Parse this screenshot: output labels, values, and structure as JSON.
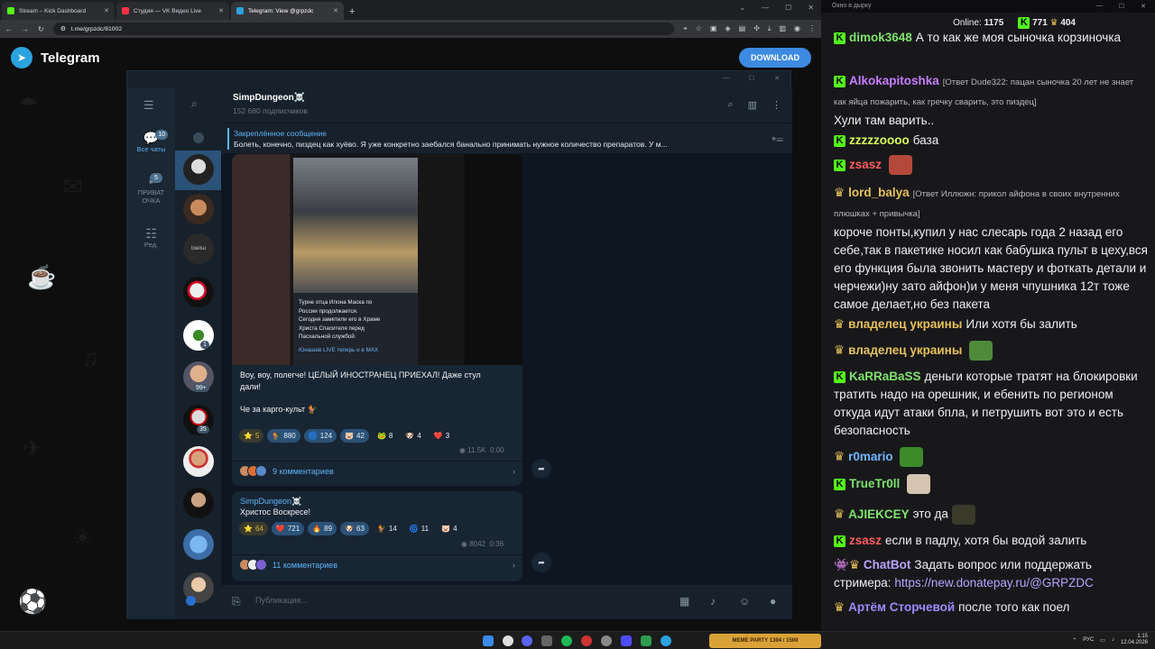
{
  "browser": {
    "tabs": [
      {
        "title": "Stream – Kick Dashboard",
        "fav_color": "#53fc18"
      },
      {
        "title": "Студия — VK Видео Live",
        "fav_color": "#ff3347"
      },
      {
        "title": "Telegram: View @grpzdc",
        "fav_color": "#2aa3de",
        "active": true
      }
    ],
    "new_tab_symbol": "+",
    "url": "t.me/grpzdc/81002"
  },
  "telegram": {
    "brand": "Telegram",
    "download_label": "DOWNLOAD",
    "folders": [
      {
        "label": "Все чаты",
        "icon": "chat-bubbles-icon",
        "badge": "10",
        "active": true
      },
      {
        "label": "ПРИВАТ ОЧКА",
        "icon": "chat-bubble-icon",
        "badge": "5"
      },
      {
        "label": "Ред.",
        "icon": "sliders-icon"
      }
    ],
    "chatlist_badges": [
      "1",
      "99+",
      "35"
    ],
    "chat_title": "SimpDungeon☠️",
    "chat_subtitle": "152 680 подписчиков",
    "pinned_title": "Закреплённое сообщение",
    "pinned_text": "Болеть, конечно, пиздец как хуёво. Я уже конкретно заебался банально принимать нужное количество препаратов. У м...",
    "post1": {
      "image_caption": [
        "Турне отца Илона Маска по",
        "России продолжается.",
        "Сегодня заметили его в Храме",
        "Христа Спасителя перед",
        "Пасхальной службой."
      ],
      "image_footer": "Юнашев LIVE теперь и в MAX",
      "text_lines": [
        "Воу, воу, полегче! ЦЕЛЫЙ ИНОСТРАНЕЦ ПРИЕХАЛ! Даже стул",
        "дали!"
      ],
      "text2": "Че за карго-культ 🐓",
      "reactions": [
        {
          "emoji": "⭐",
          "count": "5",
          "gold": true
        },
        {
          "emoji": "🐓",
          "count": "880"
        },
        {
          "emoji": "🌀",
          "count": "124"
        },
        {
          "emoji": "🐷",
          "count": "42"
        },
        {
          "emoji": "🐸",
          "count": "8"
        },
        {
          "emoji": "🐶",
          "count": "4"
        },
        {
          "emoji": "❤️",
          "count": "3"
        }
      ],
      "views": "11.5K",
      "time": "0:00",
      "comments": "9 комментариев"
    },
    "post2": {
      "author": "SimpDungeon☠️",
      "text": "Христос Воскресе!",
      "reactions": [
        {
          "emoji": "⭐",
          "count": "64",
          "gold": true
        },
        {
          "emoji": "❤️",
          "count": "721"
        },
        {
          "emoji": "🔥",
          "count": "89"
        },
        {
          "emoji": "🐶",
          "count": "63"
        },
        {
          "emoji": "🐓",
          "count": "14"
        },
        {
          "emoji": "🌀",
          "count": "11"
        },
        {
          "emoji": "🐷",
          "count": "4"
        }
      ],
      "views": "8042",
      "time": "0:36",
      "comments": "11 комментариев"
    },
    "composer_placeholder": "Публикация..."
  },
  "stream_chat": {
    "window_title": "Окно в дырку",
    "online_label": "Online:",
    "online_count": "1175",
    "kick_count": "771",
    "vk_count": "404",
    "messages": [
      {
        "platform": "kick",
        "user": "dimok3648",
        "color": "#7ee36a",
        "text": "А то как же моя сыночка корзиночка"
      },
      {
        "platform": "kick",
        "user": "Alkokapitoshka",
        "color": "#c77dff",
        "reply": "[Ответ Dude322: пацан сыночка 20 лет не знает как яйца пожарить, как гречку сварить, это пиздец]",
        "text": "Хули там варить.."
      },
      {
        "platform": "kick",
        "user": "zzzzzoooo",
        "color": "#d8ff5a",
        "text": "база"
      },
      {
        "platform": "kick",
        "user": "zsasz",
        "color": "#ff5c5c",
        "text": ""
      },
      {
        "platform": "vk",
        "user": "lord_balya",
        "color": "#e8c15a",
        "reply": "[Ответ Иллюжн: прикол айфона в своих внутренних плюшках + привычка]",
        "text": "короче понты,купил у нас слесарь года 2 назад его себе,так в пакетике носил как бабушка пульт в цеху,вся его функция была звонить мастеру и фоткать детали и черчежи)ну зато айфон)и у меня чпушника 12т тоже самое делает,но без пакета"
      },
      {
        "platform": "vk",
        "user": "владелец украины",
        "color": "#e8c15a",
        "text": "Или хотя бы залить"
      },
      {
        "platform": "vk",
        "user": "владелец украины",
        "color": "#e8c15a",
        "text": ""
      },
      {
        "platform": "kick",
        "user": "KaRRaBaSS",
        "color": "#7ee36a",
        "text": "деньги которые тратят на блокировки тратить надо на орешник, и ебенить по регионом откуда идут атаки бпла, и петрушить вот это и есть безопасность"
      },
      {
        "platform": "vk",
        "user": "r0mario",
        "color": "#6fb7ff",
        "text": ""
      },
      {
        "platform": "kick",
        "user": "TrueTr0ll",
        "color": "#7ee36a",
        "text": ""
      },
      {
        "platform": "vk",
        "user": "AJIEKCEY",
        "color": "#7ee36a",
        "text": "это да"
      },
      {
        "platform": "kick",
        "user": "zsasz",
        "color": "#ff5c5c",
        "text": "если в падлу, хотя бы водой залить"
      },
      {
        "platform": "bot",
        "user": "ChatBot",
        "color": "#b9a3ff",
        "text": "Задать вопрос или поддержать стримера:",
        "link": "https://new.donatepay.ru/@GRPZDC"
      },
      {
        "platform": "vk",
        "user": "Артём Сторчевой",
        "color": "#9b8cff",
        "text": "после того как поел"
      }
    ]
  },
  "taskbar": {
    "meme_party": "MEME PARTY",
    "meme_counter": "1304 / 1500",
    "lang": "РУС",
    "time": "1:15",
    "date": "12.04.2026"
  },
  "colors": {
    "telegram_accent": "#5eb5f7",
    "kick_green": "#53fc18",
    "download_blue": "#3d8ae0"
  }
}
